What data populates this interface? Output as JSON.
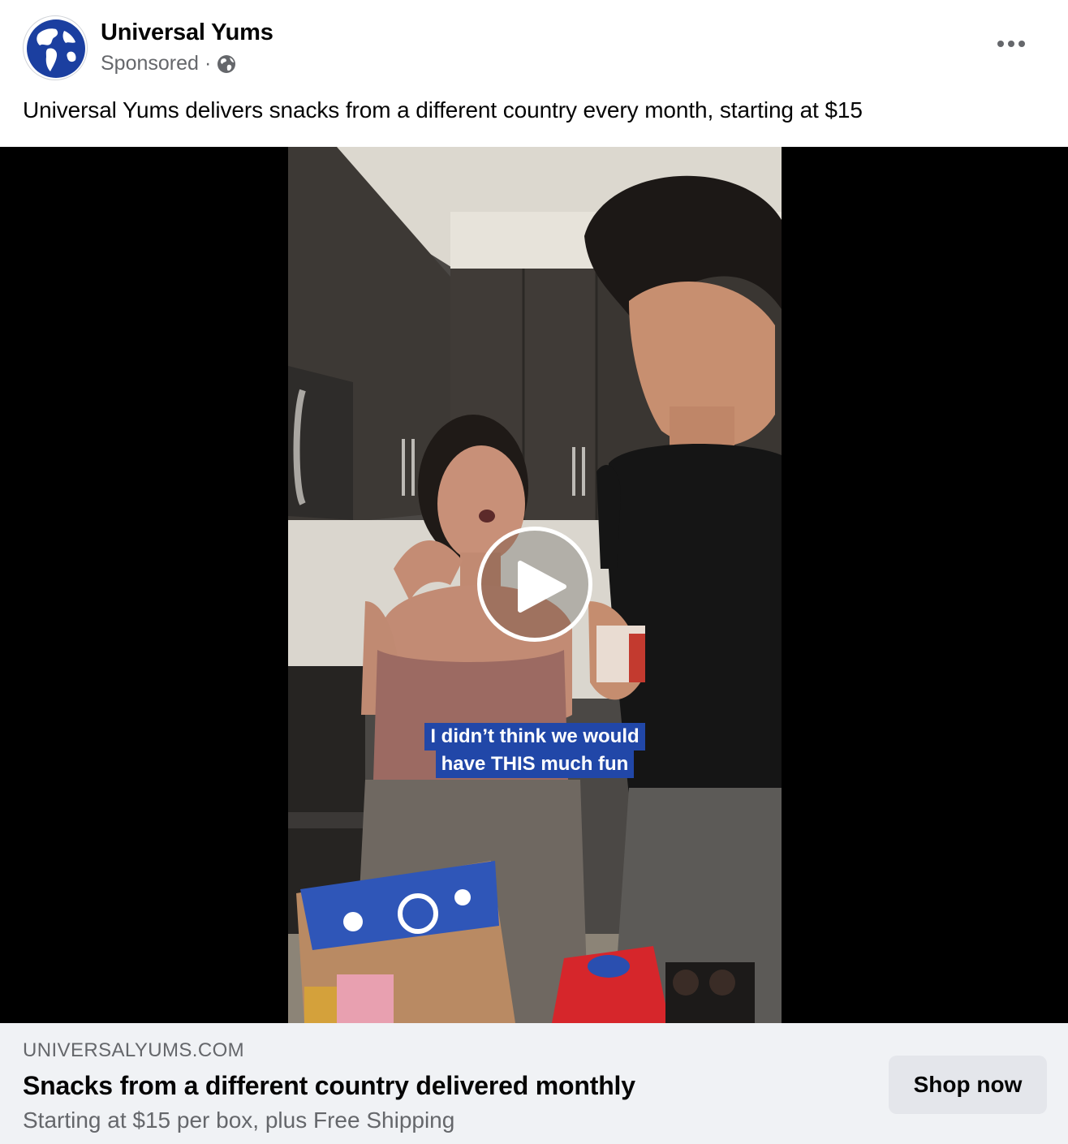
{
  "post": {
    "page_name": "Universal Yums",
    "sponsored_label": "Sponsored",
    "separator": "·",
    "audience_icon": "globe-icon",
    "more_icon": "more-options-icon",
    "caption": "Universal Yums delivers snacks from a different country every month, starting at $15"
  },
  "video": {
    "subtitle_lines": [
      "I didn’t think we would",
      "have THIS much fun"
    ],
    "play_icon": "play-icon",
    "subtitle_color": "#2147a8"
  },
  "link_card": {
    "domain": "UNIVERSALYUMS.COM",
    "headline": "Snacks from a different country delivered monthly",
    "description": "Starting at $15 per box, plus Free Shipping",
    "button_label": "Shop now"
  },
  "colors": {
    "brand_blue": "#1b3fa0",
    "secondary_text": "#65676b",
    "card_background": "#f0f2f5",
    "button_background": "#e4e6eb"
  }
}
